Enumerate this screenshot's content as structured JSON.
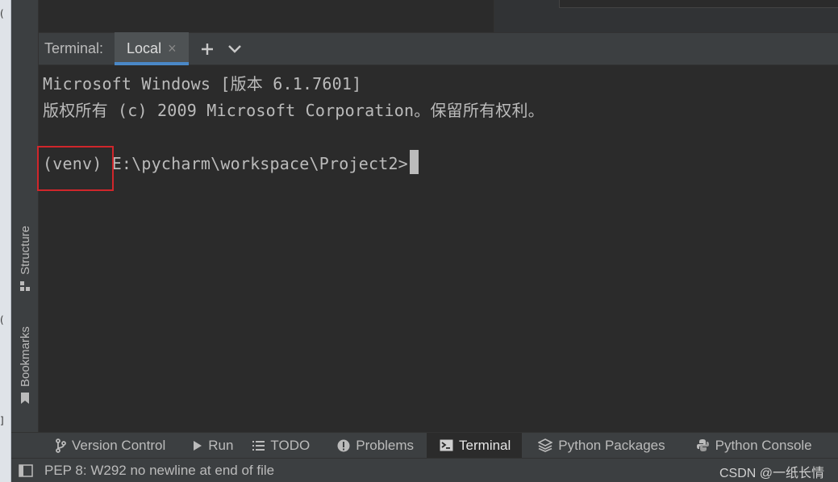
{
  "terminal": {
    "title": "Terminal:",
    "tab_label": "Local",
    "close_glyph": "×",
    "add_glyph": "+",
    "lines": {
      "line1": "Microsoft Windows [版本 6.1.7601]",
      "line2": "版权所有 (c) 2009 Microsoft Corporation。保留所有权利。",
      "prompt_venv": "(venv)",
      "prompt_path": " E:\\pycharm\\workspace\\Project2>"
    }
  },
  "left_strip": {
    "structure_label": "Structure",
    "bookmarks_label": "Bookmarks"
  },
  "tool_tabs": [
    {
      "label": "Version Control",
      "icon": "branch-icon"
    },
    {
      "label": "Run",
      "icon": "play-icon"
    },
    {
      "label": "TODO",
      "icon": "list-icon"
    },
    {
      "label": "Problems",
      "icon": "warning-icon"
    },
    {
      "label": "Terminal",
      "icon": "terminal-icon",
      "active": true
    },
    {
      "label": "Python Packages",
      "icon": "layers-icon"
    },
    {
      "label": "Python Console",
      "icon": "python-icon"
    }
  ],
  "status": {
    "message": "PEP 8: W292 no newline at end of file",
    "watermark": "CSDN @一纸长情"
  },
  "colors": {
    "accent": "#4a88c7",
    "highlight_box": "#d0262b",
    "panel": "#3c3f41",
    "editor": "#2b2b2b"
  }
}
